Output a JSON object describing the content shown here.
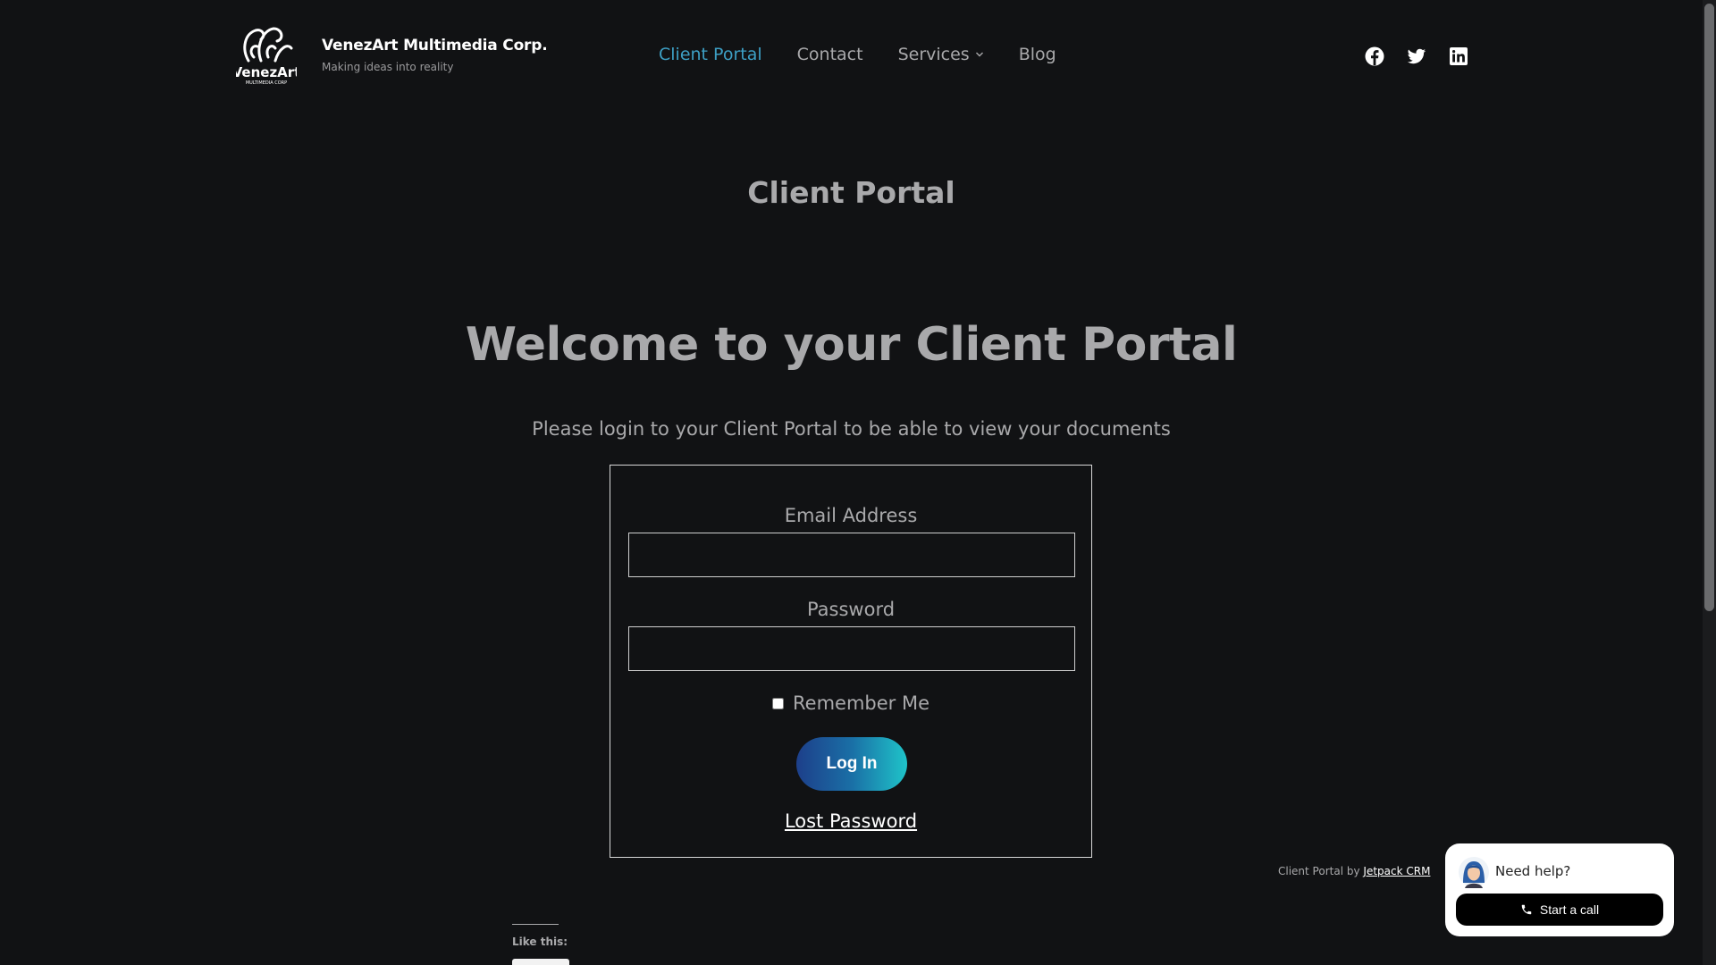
{
  "header": {
    "site_title": "VenezArt Multimedia Corp.",
    "tagline": "Making ideas into reality",
    "logo_icon": "venezart-octopus-logo",
    "nav": [
      {
        "label": "Client Portal",
        "active": true
      },
      {
        "label": "Contact",
        "active": false
      },
      {
        "label": "Services",
        "active": false,
        "dropdown": true
      },
      {
        "label": "Blog",
        "active": false
      }
    ],
    "social": [
      "facebook-icon",
      "twitter-icon",
      "linkedin-icon"
    ]
  },
  "main": {
    "page_title": "Client Portal",
    "welcome": "Welcome to your Client Portal",
    "subtitle": "Please login to your Client Portal to be able to view your documents",
    "form": {
      "email_label": "Email Address",
      "email_value": "",
      "password_label": "Password",
      "password_value": "",
      "remember_label": "Remember Me",
      "remember_checked": false,
      "login_label": "Log In",
      "lost_password": "Lost Password"
    },
    "credit_prefix": "Client Portal by",
    "credit_link": "Jetpack CRM",
    "like_label": "Like this:"
  },
  "help_widget": {
    "title": "Need help?",
    "button": "Start a call"
  },
  "colors": {
    "background": "#111214",
    "accent": "#3d9fc4",
    "button_gradient_start": "#1d3f8a",
    "button_gradient_end": "#1fc4c9"
  }
}
